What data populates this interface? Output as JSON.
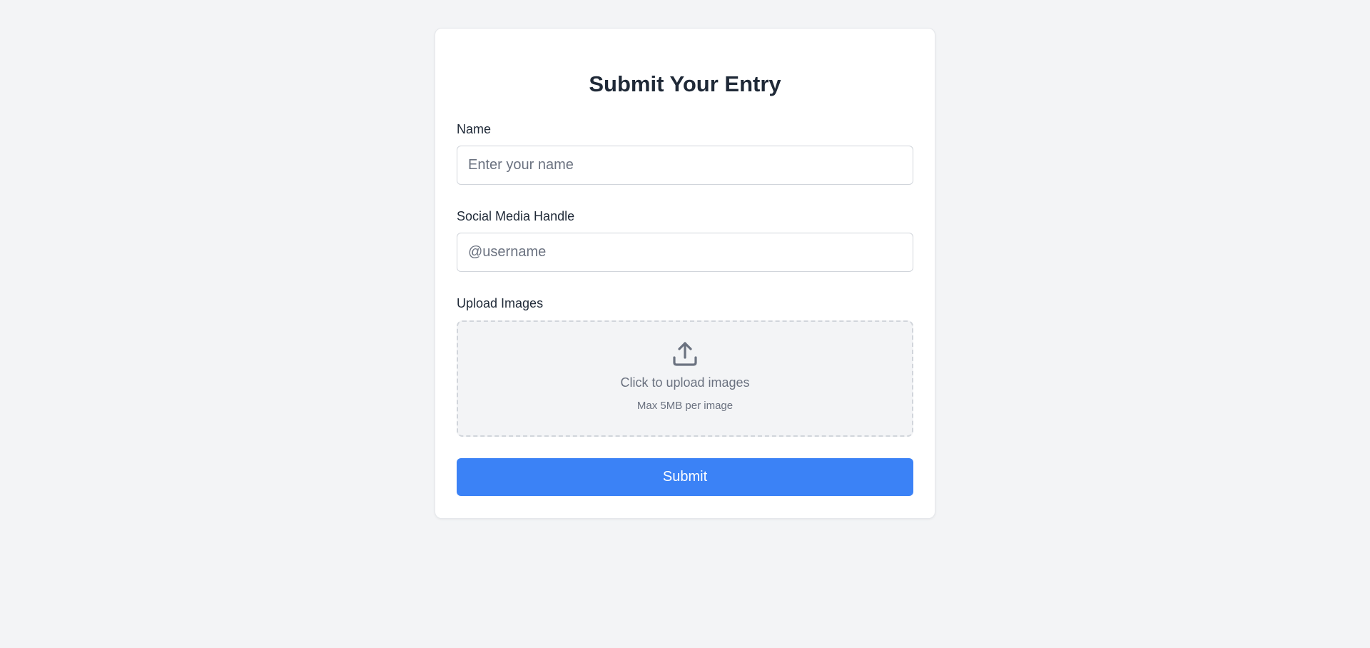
{
  "form": {
    "title": "Submit Your Entry",
    "name": {
      "label": "Name",
      "placeholder": "Enter your name",
      "value": ""
    },
    "handle": {
      "label": "Social Media Handle",
      "placeholder": "@username",
      "value": ""
    },
    "upload": {
      "label": "Upload Images",
      "icon": "upload-icon",
      "prompt": "Click to upload images",
      "hint": "Max 5MB per image"
    },
    "submit_label": "Submit"
  },
  "colors": {
    "page_background": "#f3f4f6",
    "card_background": "#ffffff",
    "primary_button": "#3b82f6",
    "title_text": "#1f2937",
    "muted_text": "#6b7280"
  }
}
